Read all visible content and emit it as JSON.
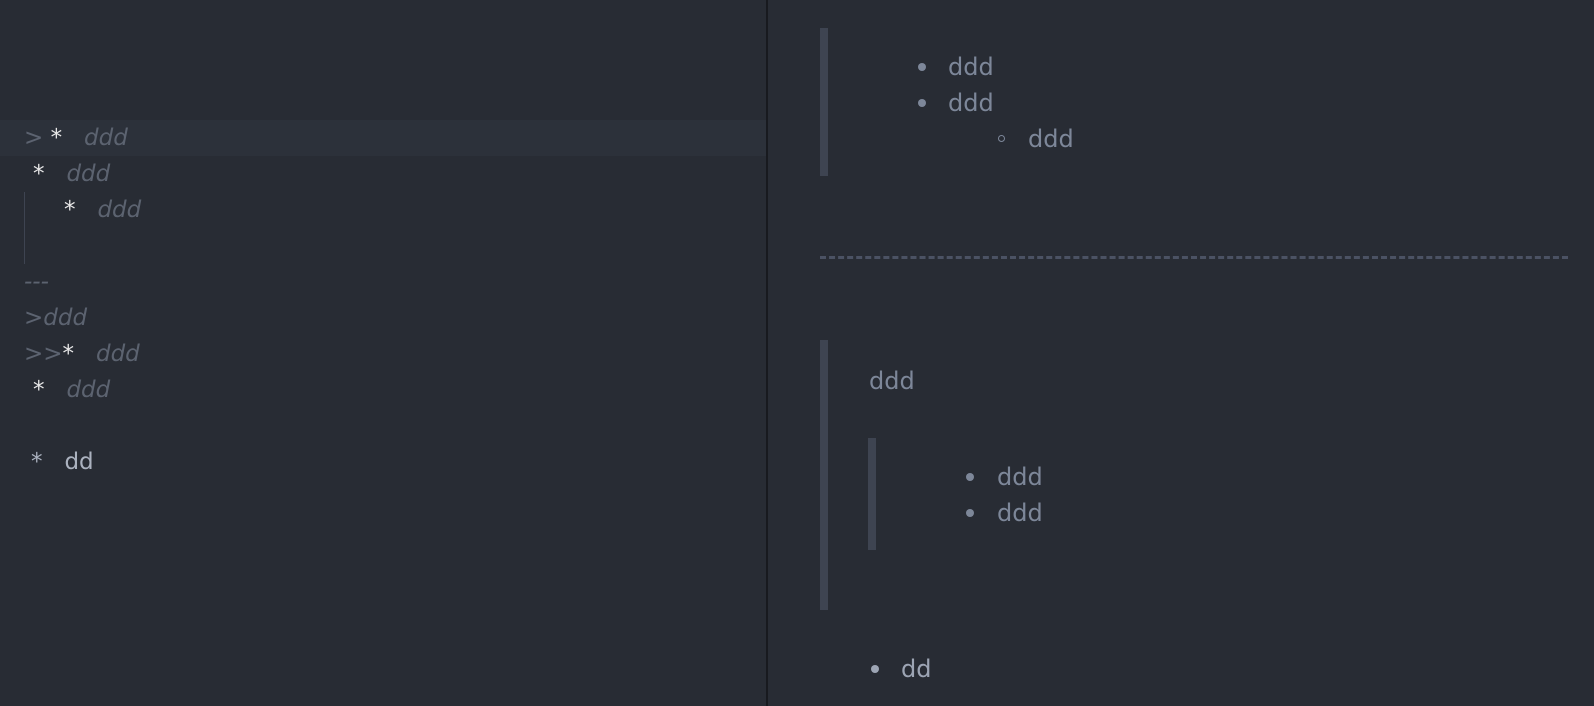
{
  "editor": {
    "lines": [
      {
        "prefix": ">",
        "marker": "*",
        "text": "ddd"
      },
      {
        "prefix": "",
        "marker": "*",
        "text": "ddd"
      },
      {
        "prefix": "",
        "marker": "*",
        "text": "ddd"
      },
      {
        "text": "---"
      },
      {
        "text": ">ddd"
      },
      {
        "prefix": ">>",
        "marker": "*",
        "text": "ddd"
      },
      {
        "prefix": "",
        "marker": "*",
        "text": "ddd"
      },
      {
        "prefix": "",
        "marker": "*",
        "text": "dd"
      }
    ]
  },
  "preview": {
    "quote1_items": [
      "ddd",
      "ddd"
    ],
    "quote1_nested_item": "ddd",
    "quote2_paragraph": "ddd",
    "quote2_nested_items": [
      "ddd",
      "ddd"
    ],
    "final_item": "dd"
  },
  "colors": {
    "background": "#282c34",
    "active_line": "#2c313a",
    "quote_bar": "#3e4451",
    "muted_text": "#5c6370",
    "preview_text": "#7d8799",
    "marker": "#e8e8e8"
  }
}
